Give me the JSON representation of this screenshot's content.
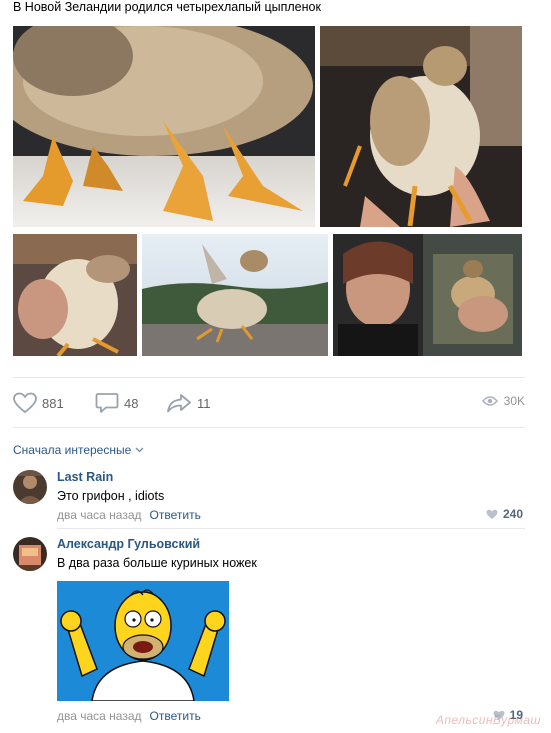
{
  "post": {
    "title": "В Новой Зеландии родился четырехлапый цыпленок"
  },
  "actions": {
    "likes": "881",
    "comments": "48",
    "shares": "11",
    "views": "30K"
  },
  "comments_sort": "Сначала интересные",
  "comments": [
    {
      "author": "Last Rain",
      "text": "Это грифон , idiots",
      "time": "два часа назад",
      "reply": "Ответить",
      "likes": "240"
    },
    {
      "author": "Александр Гульовский",
      "text": "В два раза больше куриных ножек",
      "time": "два часа назад",
      "reply": "Ответить",
      "likes": "19"
    }
  ],
  "watermark": "АпельсинБурмаш",
  "colors": {
    "link": "#2a5885",
    "muted": "#939393",
    "divider": "#e7e8ec",
    "homer_bg": "#1d8ad8"
  }
}
